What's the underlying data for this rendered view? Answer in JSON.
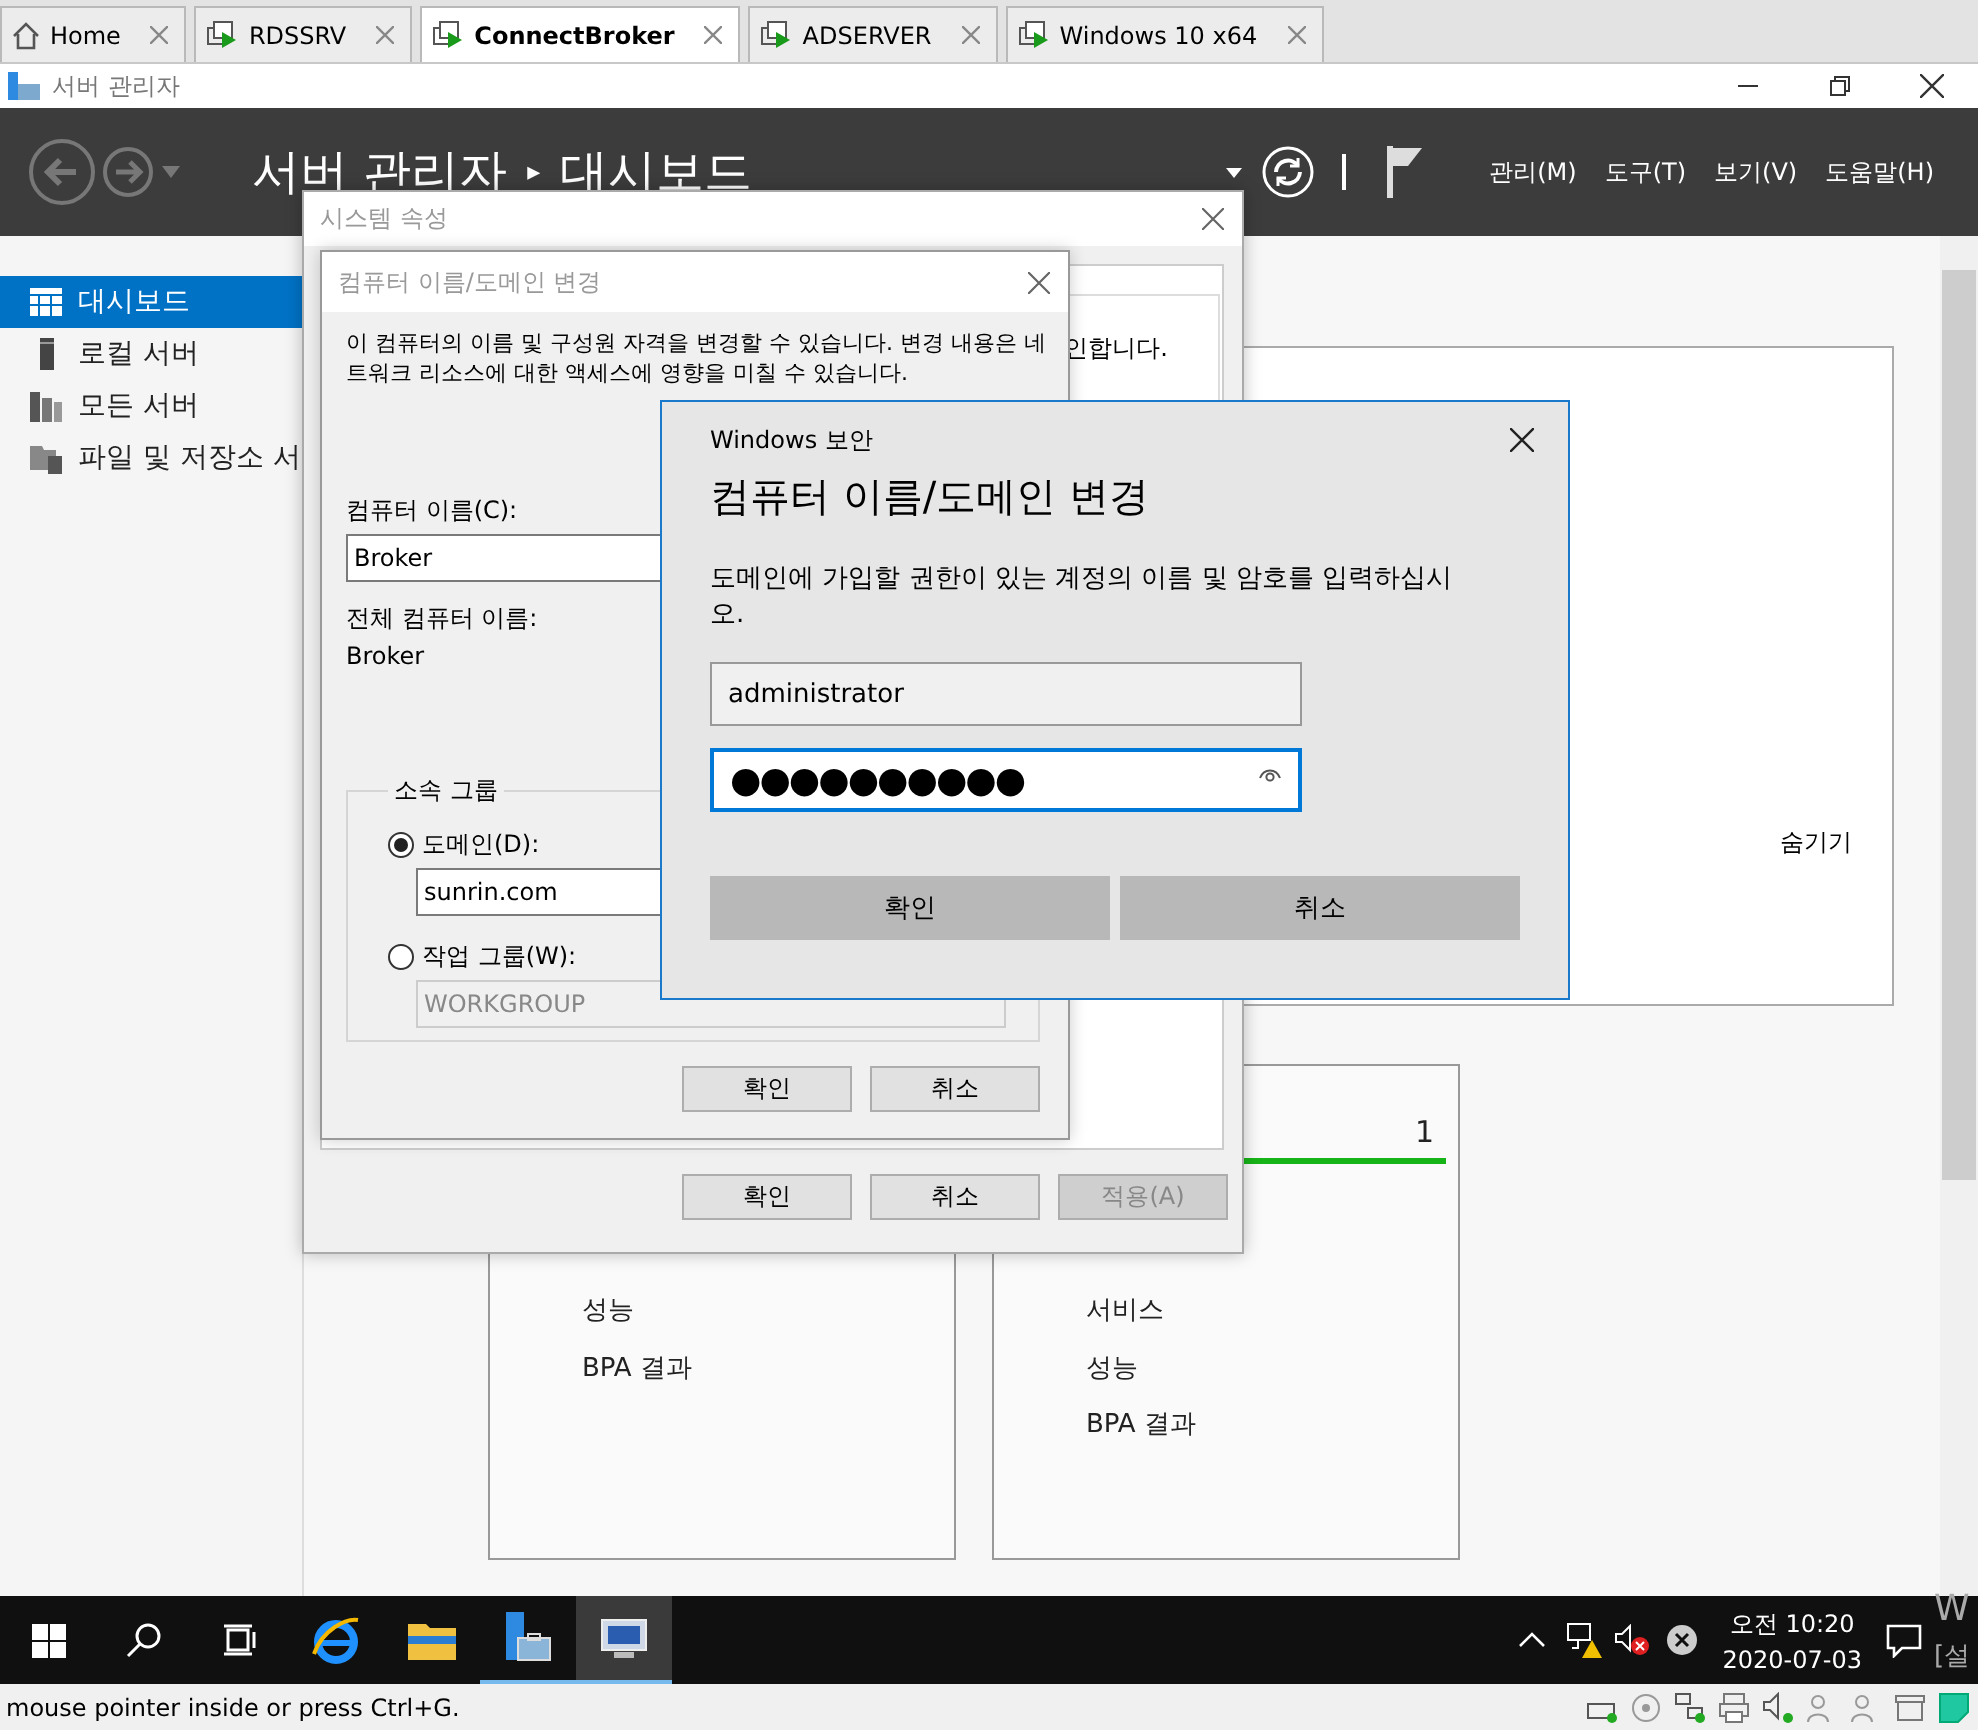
{
  "vm_tabs": [
    {
      "label": "Home",
      "kind": "home",
      "selected": false
    },
    {
      "label": "RDSSRV",
      "kind": "vm",
      "selected": false
    },
    {
      "label": "ConnectBroker",
      "kind": "vm",
      "selected": true
    },
    {
      "label": "ADSERVER",
      "kind": "vm",
      "selected": false
    },
    {
      "label": "Windows 10 x64",
      "kind": "vm",
      "selected": false
    }
  ],
  "window": {
    "title": "서버 관리자"
  },
  "header": {
    "breadcrumb_root": "서버 관리자",
    "separator": "▸",
    "breadcrumb_current": "대시보드",
    "menus": [
      "관리(M)",
      "도구(T)",
      "보기(V)",
      "도움말(H)"
    ]
  },
  "sidebar": {
    "items": [
      {
        "label": "대시보드",
        "kind": "dashboard",
        "selected": true
      },
      {
        "label": "로컬 서버",
        "kind": "server",
        "selected": false
      },
      {
        "label": "모든 서버",
        "kind": "servers",
        "selected": false
      },
      {
        "label": "파일 및 저장소 서",
        "kind": "files",
        "selected": false
      }
    ]
  },
  "dashboard": {
    "hide_link": "숨기기",
    "tiles": [
      {
        "items": [
          "성능",
          "BPA 결과"
        ]
      },
      {
        "count": "1",
        "items": [
          "서비스",
          "성능",
          "BPA 결과"
        ]
      }
    ]
  },
  "system_properties": {
    "title": "시스템 속성",
    "text_fragment": "인합니다.",
    "buttons": [
      {
        "label": "확인",
        "disabled": false
      },
      {
        "label": "취소",
        "disabled": false
      },
      {
        "label": "적용(A)",
        "disabled": true
      }
    ]
  },
  "name_change_dialog": {
    "title": "컴퓨터 이름/도메인 변경",
    "description": "이 컴퓨터의 이름 및 구성원 자격을 변경할 수 있습니다. 변경 내용은 네트워크 리소스에 대한 액세스에 영향을 미칠 수 있습니다.",
    "computer_name_label": "컴퓨터 이름(C):",
    "computer_name": "Broker",
    "full_name_label": "전체 컴퓨터 이름:",
    "full_name": "Broker",
    "member_of": {
      "legend": "소속 그룹",
      "options": [
        {
          "label": "도메인(D):",
          "selected": true,
          "value": "sunrin.com"
        },
        {
          "label": "작업 그룹(W):",
          "selected": false,
          "value": "WORKGROUP"
        }
      ]
    },
    "buttons": [
      "확인",
      "취소"
    ]
  },
  "security_dialog": {
    "caption": "Windows 보안",
    "title": "컴퓨터 이름/도메인 변경",
    "message": "도메인에 가입할 권한이 있는 계정의 이름 및 암호를 입력하십시오.",
    "username": "administrator",
    "password": "●●●●●●●●●●",
    "buttons": [
      "확인",
      "취소"
    ]
  },
  "taskbar": {
    "apps": [
      {
        "kind": "browser",
        "running": false,
        "selected": false
      },
      {
        "kind": "folder",
        "running": false,
        "selected": false
      },
      {
        "kind": "server-manager",
        "running": true,
        "selected": false
      },
      {
        "kind": "remote",
        "running": true,
        "selected": true
      }
    ],
    "time": "오전 10:20",
    "date": "2020-07-03"
  },
  "activation_notice": [
    "W",
    "[설"
  ],
  "status_bar": {
    "text": "mouse pointer inside or press Ctrl+G."
  }
}
